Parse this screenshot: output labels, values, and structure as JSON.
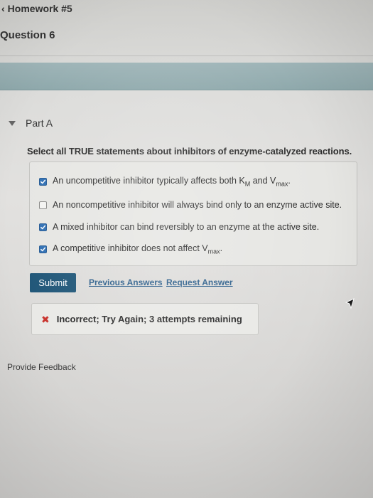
{
  "header": {
    "back_label": "Homework #5",
    "question_title": "Question 6"
  },
  "part": {
    "label": "Part A",
    "prompt": "Select all TRUE statements about inhibitors of enzyme-catalyzed reactions."
  },
  "choices": [
    {
      "checked": true,
      "text_before": "An uncompetitive inhibitor typically affects both K",
      "sub1": "M",
      "text_mid": " and V",
      "sub2": "max",
      "text_after": "."
    },
    {
      "checked": false,
      "text": "An noncompetitive inhibitor will always bind only to an enzyme active site."
    },
    {
      "checked": true,
      "text": "A mixed inhibitor can bind reversibly to an enzyme at the active site."
    },
    {
      "checked": true,
      "text_before": "A competitive inhibitor does not affect V",
      "sub": "max",
      "text_after": "."
    }
  ],
  "actions": {
    "submit_label": "Submit",
    "previous_answers_label": "Previous Answers",
    "request_answer_label": "Request Answer"
  },
  "feedback": {
    "status_text": "Incorrect; Try Again; 3 attempts remaining",
    "status_color": "#c8322c"
  },
  "footer": {
    "provide_feedback_label": "Provide Feedback"
  },
  "colors": {
    "banner": "#9fb5b8",
    "submit_button": "#1e5577",
    "checkbox_checked": "#2f6fb3",
    "link": "#2a5d8a"
  }
}
